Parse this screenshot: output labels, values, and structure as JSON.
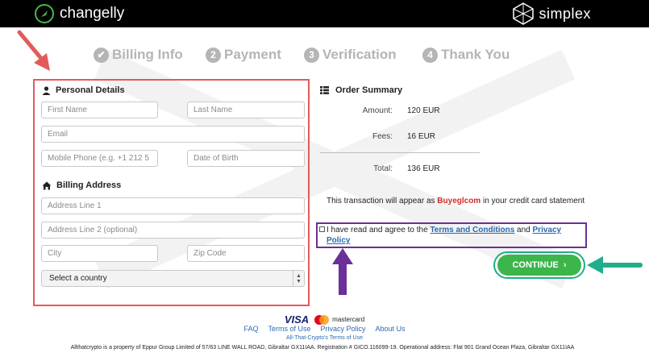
{
  "header": {
    "brand": "changelly",
    "partner": "simplex"
  },
  "steps": [
    {
      "num": "✔",
      "label": "Billing Info"
    },
    {
      "num": "2",
      "label": "Payment"
    },
    {
      "num": "3",
      "label": "Verification"
    },
    {
      "num": "4",
      "label": "Thank You"
    }
  ],
  "personal": {
    "title": "Personal Details",
    "first_name_placeholder": "First Name",
    "last_name_placeholder": "Last Name",
    "email_placeholder": "Email",
    "phone_placeholder": "Mobile Phone (e.g. +1 212 5",
    "dob_placeholder": "Date of Birth"
  },
  "billing": {
    "title": "Billing Address",
    "address1_placeholder": "Address Line 1",
    "address2_placeholder": "Address Line 2 (optional)",
    "city_placeholder": "City",
    "zip_placeholder": "Zip Code",
    "country_selected": "Select a country"
  },
  "summary": {
    "title": "Order Summary",
    "amount_label": "Amount:",
    "amount_value": "120 EUR",
    "fees_label": "Fees:",
    "fees_value": "16 EUR",
    "total_label": "Total:",
    "total_value": "136 EUR"
  },
  "notice": {
    "prefix": "This transaction will appear as",
    "merchant": "Buyeglcom",
    "suffix": "in your credit card statement"
  },
  "agreement": {
    "text": "I have read and agree to the",
    "terms_link": "Terms and Conditions",
    "and": "and",
    "privacy_link": "Privacy Policy"
  },
  "continue_label": "CONTINUE",
  "footer": {
    "visa": "VISA",
    "mastercard": "mastercard",
    "links": [
      "FAQ",
      "Terms of Use",
      "Privacy Policy",
      "About Us"
    ],
    "sub": "All-That-Crypto's Terms of Use",
    "legal": "Allthatcrypto is a property of Eppur Group Limited of 57/63 LINE WALL ROAD, Gibraltar GX11IAA. Registration # GICO.116099-19. Operational address: Flat 901 Grand Ocean Plaza, Gibraltar GX11IAA"
  },
  "colors": {
    "highlight_red": "#e45a5a",
    "highlight_purple": "#6a2f99",
    "highlight_teal": "#1fae8a",
    "continue_green": "#3cb54a"
  }
}
